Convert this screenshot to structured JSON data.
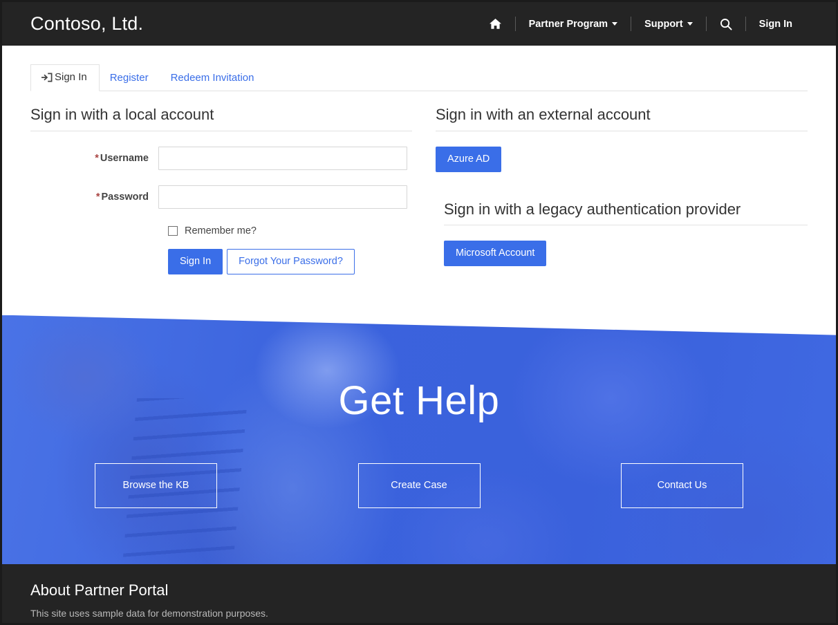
{
  "header": {
    "brand": "Contoso, Ltd.",
    "nav": [
      {
        "id": "home",
        "label": "",
        "icon": "home-icon",
        "caret": false
      },
      {
        "id": "partner-program",
        "label": "Partner Program",
        "icon": "",
        "caret": true
      },
      {
        "id": "support",
        "label": "Support",
        "icon": "",
        "caret": true
      },
      {
        "id": "search",
        "label": "",
        "icon": "search-icon",
        "caret": false
      },
      {
        "id": "sign-in",
        "label": "Sign In",
        "icon": "",
        "caret": false
      }
    ]
  },
  "tabs": [
    {
      "id": "sign-in",
      "label": "Sign In",
      "active": true,
      "icon": "sign-in-icon"
    },
    {
      "id": "register",
      "label": "Register",
      "active": false,
      "icon": ""
    },
    {
      "id": "redeem-invitation",
      "label": "Redeem Invitation",
      "active": false,
      "icon": ""
    }
  ],
  "local_account": {
    "heading": "Sign in with a local account",
    "username": {
      "label": "Username",
      "required_marker": "*",
      "value": "",
      "placeholder": ""
    },
    "password": {
      "label": "Password",
      "required_marker": "*",
      "value": "",
      "placeholder": ""
    },
    "remember_label": "Remember me?",
    "remember_checked": false,
    "submit_label": "Sign In",
    "forgot_label": "Forgot Your Password?"
  },
  "external_account": {
    "heading": "Sign in with an external account",
    "provider_label": "Azure AD"
  },
  "legacy_account": {
    "heading": "Sign in with a legacy authentication provider",
    "provider_label": "Microsoft Account"
  },
  "hero": {
    "title": "Get Help",
    "buttons": [
      {
        "id": "browse-kb",
        "label": "Browse the KB"
      },
      {
        "id": "create-case",
        "label": "Create Case"
      },
      {
        "id": "contact-us",
        "label": "Contact Us"
      }
    ]
  },
  "footer": {
    "title": "About Partner Portal",
    "subtitle": "This site uses sample data for demonstration purposes."
  },
  "colors": {
    "header_bg": "#242424",
    "accent_blue": "#3a6ee8",
    "hero_blue": "#3b63dd",
    "required_red": "#a94442",
    "footer_bg": "#242424"
  }
}
